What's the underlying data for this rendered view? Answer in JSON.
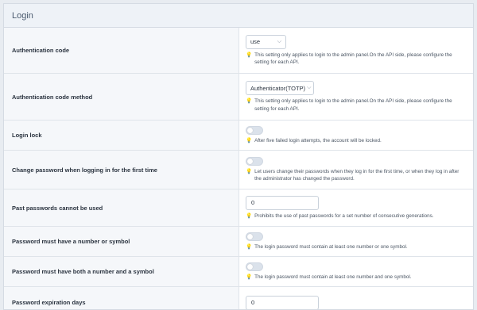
{
  "panel": {
    "title": "Login"
  },
  "rows": [
    {
      "label": "Authentication code",
      "control": {
        "type": "select",
        "value": "use"
      },
      "hint": "This setting only applies to login to the admin panel.On the API side, please configure the setting for each API."
    },
    {
      "label": "Authentication code method",
      "control": {
        "type": "select",
        "value": "Authenticator(TOTP)"
      },
      "hint": "This setting only applies to login to the admin panel.On the API side, please configure the setting for each API."
    },
    {
      "label": "Login lock",
      "control": {
        "type": "toggle",
        "value": "off"
      },
      "hint": "After five failed login attempts, the account will be locked."
    },
    {
      "label": "Change password when logging in for the first time",
      "control": {
        "type": "toggle",
        "value": "off"
      },
      "hint": "Let users change their passwords when they log in for the first time, or when they log in after the administrator has changed the password."
    },
    {
      "label": "Past passwords cannot be used",
      "control": {
        "type": "input",
        "value": "0"
      },
      "hint": "Prohibits the use of past passwords for a set number of consecutive generations."
    },
    {
      "label": "Password must have a number or symbol",
      "control": {
        "type": "toggle",
        "value": "off"
      },
      "hint": "The login password must contain at least one number or one symbol."
    },
    {
      "label": "Password must have both a number and a symbol",
      "control": {
        "type": "toggle",
        "value": "off"
      },
      "hint": "The login password must contain at least one number and one symbol."
    },
    {
      "label": "Password expiration days",
      "control": {
        "type": "input",
        "value": "0"
      },
      "hint": ""
    }
  ],
  "colors": {
    "hint_icon": "#e0812b",
    "label_bg": "#f5f7fa",
    "header_bg": "#eef2f7"
  },
  "icons": {
    "hint": "lightbulb-icon",
    "select": "chevron-down-icon"
  }
}
